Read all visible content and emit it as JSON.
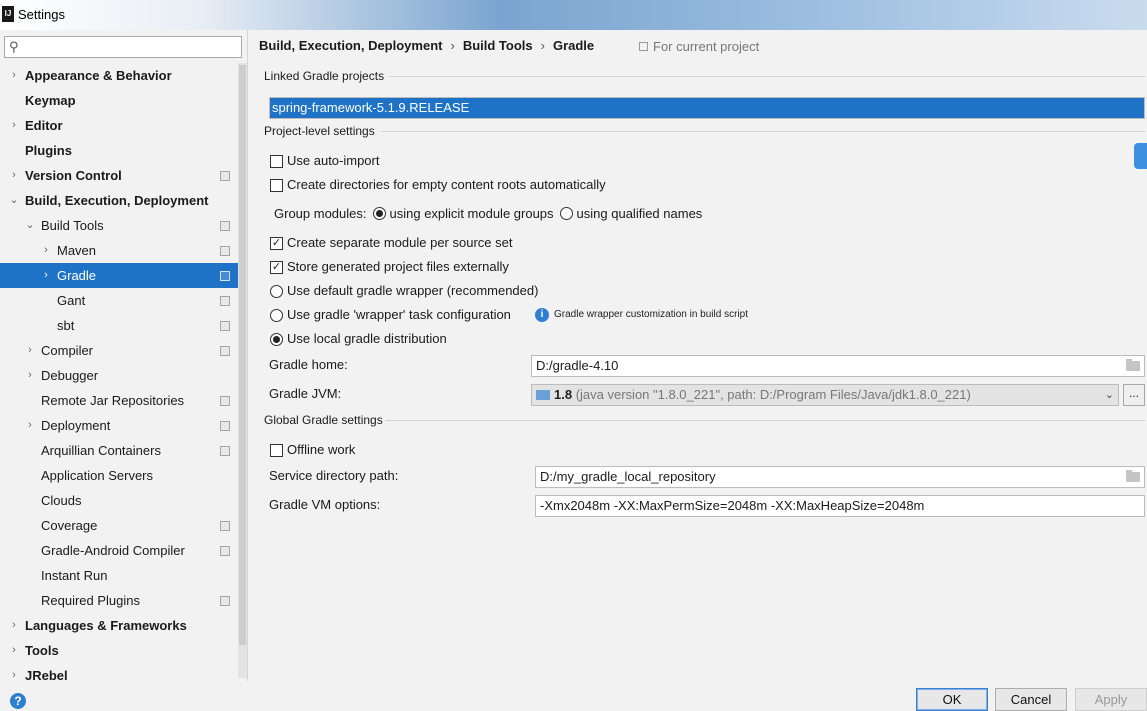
{
  "window": {
    "title": "Settings",
    "logo": "IJ"
  },
  "search": {
    "placeholder": "",
    "value": ""
  },
  "tree": [
    {
      "label": "Appearance & Behavior",
      "bold": true,
      "chevron": "›",
      "proj": false
    },
    {
      "label": "Keymap",
      "bold": true,
      "chevron": "",
      "proj": false
    },
    {
      "label": "Editor",
      "bold": true,
      "chevron": "›",
      "proj": false
    },
    {
      "label": "Plugins",
      "bold": true,
      "chevron": "",
      "proj": false
    },
    {
      "label": "Version Control",
      "bold": true,
      "chevron": "›",
      "proj": true
    },
    {
      "label": "Build, Execution, Deployment",
      "bold": true,
      "chevron": "⌄",
      "proj": false
    },
    {
      "label": "Build Tools",
      "bold": false,
      "chevron": "⌄",
      "proj": true
    },
    {
      "label": "Maven",
      "bold": false,
      "chevron": "›",
      "proj": true
    },
    {
      "label": "Gradle",
      "bold": false,
      "chevron": "›",
      "proj": true,
      "selected": true
    },
    {
      "label": "Gant",
      "bold": false,
      "chevron": "",
      "proj": true
    },
    {
      "label": "sbt",
      "bold": false,
      "chevron": "",
      "proj": true
    },
    {
      "label": "Compiler",
      "bold": false,
      "chevron": "›",
      "proj": true
    },
    {
      "label": "Debugger",
      "bold": false,
      "chevron": "›",
      "proj": false
    },
    {
      "label": "Remote Jar Repositories",
      "bold": false,
      "chevron": "",
      "proj": true
    },
    {
      "label": "Deployment",
      "bold": false,
      "chevron": "›",
      "proj": true
    },
    {
      "label": "Arquillian Containers",
      "bold": false,
      "chevron": "",
      "proj": true
    },
    {
      "label": "Application Servers",
      "bold": false,
      "chevron": "",
      "proj": false
    },
    {
      "label": "Clouds",
      "bold": false,
      "chevron": "",
      "proj": false
    },
    {
      "label": "Coverage",
      "bold": false,
      "chevron": "",
      "proj": true
    },
    {
      "label": "Gradle-Android Compiler",
      "bold": false,
      "chevron": "",
      "proj": true
    },
    {
      "label": "Instant Run",
      "bold": false,
      "chevron": "",
      "proj": false
    },
    {
      "label": "Required Plugins",
      "bold": false,
      "chevron": "",
      "proj": true
    },
    {
      "label": "Languages & Frameworks",
      "bold": true,
      "chevron": "›",
      "proj": false
    },
    {
      "label": "Tools",
      "bold": true,
      "chevron": "›",
      "proj": false
    },
    {
      "label": "JRebel",
      "bold": true,
      "chevron": "›",
      "proj": false
    }
  ],
  "breadcrumb": {
    "part1": "Build, Execution, Deployment",
    "part2": "Build Tools",
    "part3": "Gradle",
    "separator": "›",
    "note": "For current project"
  },
  "linked": {
    "section_title": "Linked Gradle projects",
    "project": "spring-framework-5.1.9.RELEASE"
  },
  "project_settings": {
    "section_title": "Project-level settings",
    "auto_import": {
      "label": "Use auto-import",
      "checked": false
    },
    "create_dirs": {
      "label": "Create directories for empty content roots automatically",
      "checked": false
    },
    "group_modules_label": "Group modules:",
    "group_explicit": {
      "label": "using explicit module groups",
      "checked": true
    },
    "group_qualified": {
      "label": "using qualified names",
      "checked": false
    },
    "separate_module": {
      "label": "Create separate module per source set",
      "checked": true
    },
    "store_external": {
      "label": "Store generated project files externally",
      "checked": true
    },
    "default_wrapper": {
      "label": "Use default gradle wrapper (recommended)",
      "checked": false
    },
    "wrapper_task": {
      "label": "Use gradle 'wrapper' task configuration",
      "checked": false
    },
    "wrapper_info": "Gradle wrapper customization in build script",
    "local_distribution": {
      "label": "Use local gradle distribution",
      "checked": true
    },
    "gradle_home_label": "Gradle home:",
    "gradle_home_value": "D:/gradle-4.10",
    "gradle_jvm_label": "Gradle JVM:",
    "gradle_jvm_version": "1.8",
    "gradle_jvm_detail": "(java version \"1.8.0_221\", path: D:/Program Files/Java/jdk1.8.0_221)",
    "dots": "..."
  },
  "global_settings": {
    "section_title": "Global Gradle settings",
    "offline": {
      "label": "Offline work",
      "checked": false
    },
    "service_dir_label": "Service directory path:",
    "service_dir_value": "D:/my_gradle_local_repository",
    "vm_options_label": "Gradle VM options:",
    "vm_options_value": "-Xmx2048m -XX:MaxPermSize=2048m -XX:MaxHeapSize=2048m"
  },
  "footer": {
    "help": "?",
    "ok": "OK",
    "cancel": "Cancel",
    "apply": "Apply"
  },
  "colors": {
    "selection": "#1e73c6",
    "background": "#f2f2f2"
  }
}
